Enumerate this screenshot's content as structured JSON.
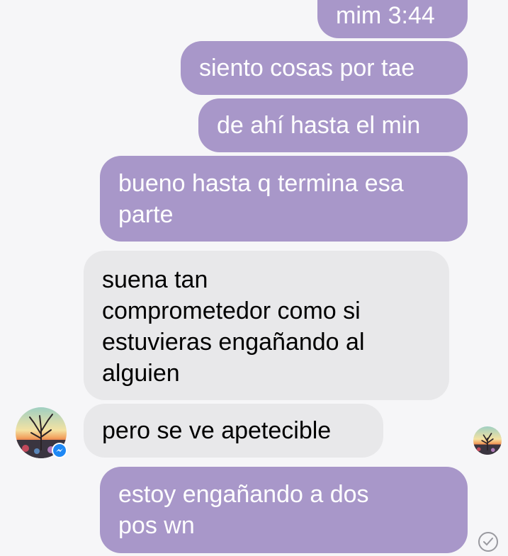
{
  "colors": {
    "outgoing_bubble": "#a897c9",
    "incoming_bubble": "#e8e8ea",
    "background": "#f6f6f8",
    "messenger_badge": "#1e88f5"
  },
  "messages": [
    {
      "sender": "me",
      "text": "mim 3:44"
    },
    {
      "sender": "me",
      "text": "siento cosas por tae"
    },
    {
      "sender": "me",
      "text": "de ahí hasta el min"
    },
    {
      "sender": "me",
      "lines": [
        "bueno hasta q termina esa",
        "parte"
      ]
    },
    {
      "sender": "them",
      "lines": [
        "suena tan",
        "comprometedor como si",
        "estuvieras engañando al",
        "alguien"
      ]
    },
    {
      "sender": "them",
      "text": "pero se ve apetecible"
    },
    {
      "sender": "me",
      "lines": [
        "estoy engañando a dos",
        "pos wn"
      ]
    }
  ],
  "icons": {
    "contact_avatar": "tree-sunset-avatar",
    "badge": "messenger-icon",
    "read_receipt_avatar": "tree-sunset-avatar",
    "delivery_status": "check-circle-icon"
  }
}
